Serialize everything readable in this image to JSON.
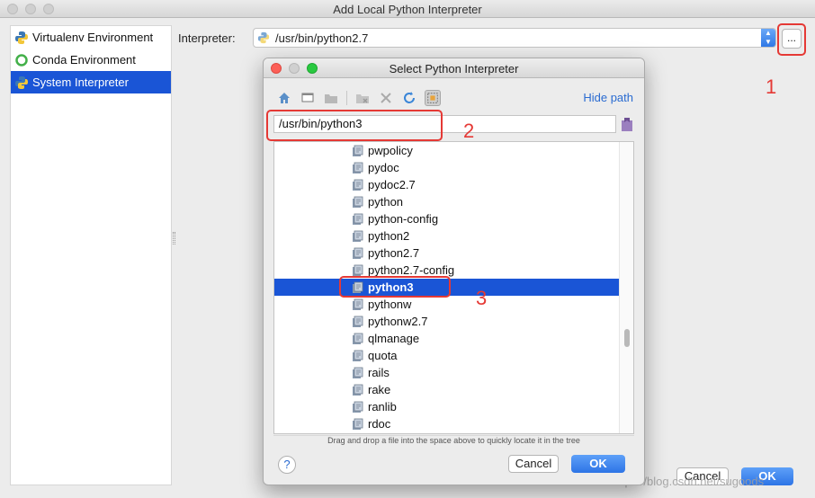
{
  "window": {
    "title": "Add Local Python Interpreter"
  },
  "sidebar": {
    "items": [
      {
        "label": "Virtualenv Environment",
        "icon": "python-icon",
        "selected": false
      },
      {
        "label": "Conda Environment",
        "icon": "conda-ring-icon",
        "selected": false
      },
      {
        "label": "System Interpreter",
        "icon": "python-icon",
        "selected": true
      }
    ]
  },
  "interpreter": {
    "label": "Interpreter:",
    "value": "/usr/bin/python2.7",
    "browse_label": "..."
  },
  "annotations": [
    "1",
    "2",
    "3"
  ],
  "dialog": {
    "title": "Select Python Interpreter",
    "toolbar_icons": [
      "home-icon",
      "desktop-icon",
      "new-folder-icon",
      "folder-delete-icon",
      "close-icon",
      "refresh-icon",
      "show-hidden-icon"
    ],
    "hide_path_label": "Hide path",
    "path_value": "/usr/bin/python3",
    "tree_items": [
      "pwpolicy",
      "pydoc",
      "pydoc2.7",
      "python",
      "python-config",
      "python2",
      "python2.7",
      "python2.7-config",
      "python3",
      "pythonw",
      "pythonw2.7",
      "qlmanage",
      "quota",
      "rails",
      "rake",
      "ranlib",
      "rdoc"
    ],
    "selected_item": "python3",
    "hint": "Drag and drop a file into the space above to quickly locate it in the tree",
    "help_label": "?",
    "cancel_label": "Cancel",
    "ok_label": "OK"
  },
  "footer": {
    "cancel_label": "Cancel",
    "ok_label": "OK"
  },
  "watermark": "https://blog.csdn.net/sugoods"
}
